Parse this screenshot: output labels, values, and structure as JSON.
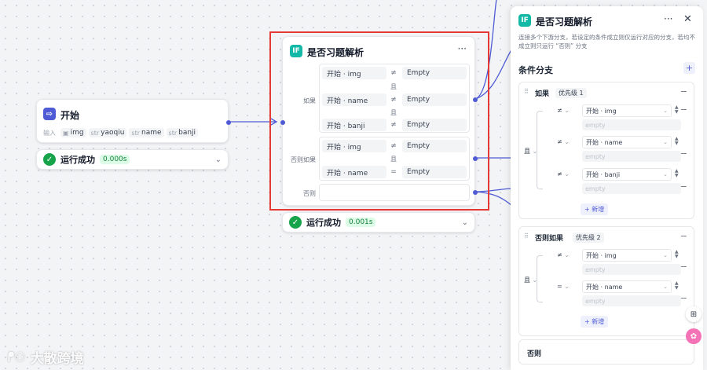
{
  "start_node": {
    "title": "开始",
    "input_label": "输入",
    "inputs": [
      {
        "type": "img-icon",
        "name": "img"
      },
      {
        "type": "str",
        "name": "yaoqiu"
      },
      {
        "type": "str",
        "name": "name"
      },
      {
        "type": "str",
        "name": "banji"
      }
    ],
    "status_label": "运行成功",
    "time": "0.000s"
  },
  "if_node": {
    "icon": "IF",
    "title": "是否习题解析",
    "label_if": "如果",
    "label_elif": "否则如果",
    "label_else": "否则",
    "and": "且",
    "rows": [
      {
        "var": "开始  ·  img",
        "op": "≠",
        "value": "Empty"
      },
      {
        "var": "开始  ·  name",
        "op": "≠",
        "value": "Empty"
      },
      {
        "var": "开始  ·  banji",
        "op": "≠",
        "value": "Empty"
      },
      {
        "var": "开始  ·  img",
        "op": "≠",
        "value": "Empty"
      },
      {
        "var": "开始  ·  name",
        "op": "=",
        "value": "Empty"
      }
    ],
    "status_label": "运行成功",
    "time": "0.001s"
  },
  "panel": {
    "icon": "IF",
    "title": "是否习题解析",
    "description": "连接多个下游分支，若设定的条件成立则仅运行对应的分支，若均不成立则只运行 “否则” 分支",
    "section_title": "条件分支",
    "branch1": {
      "label": "如果",
      "priority": "优先级 1",
      "logic": "且",
      "conditions": [
        {
          "op": "≠",
          "var": "开始 · img",
          "placeholder": "empty"
        },
        {
          "op": "≠",
          "var": "开始 · name",
          "placeholder": "empty"
        },
        {
          "op": "≠",
          "var": "开始 · banji",
          "placeholder": "empty"
        }
      ],
      "add_label": "+ 新增"
    },
    "branch2": {
      "label": "否则如果",
      "priority": "优先级 2",
      "logic": "且",
      "conditions": [
        {
          "op": "≠",
          "var": "开始 · img",
          "placeholder": "empty"
        },
        {
          "op": "=",
          "var": "开始 · name",
          "placeholder": "empty"
        }
      ],
      "add_label": "+ 新增"
    },
    "else_label": "否则"
  },
  "watermark": "大散跨境",
  "colors": {
    "accent": "#4f5bd5",
    "if_icon": "#14b8a6",
    "highlight": "#e53935",
    "success": "#16a34a"
  }
}
